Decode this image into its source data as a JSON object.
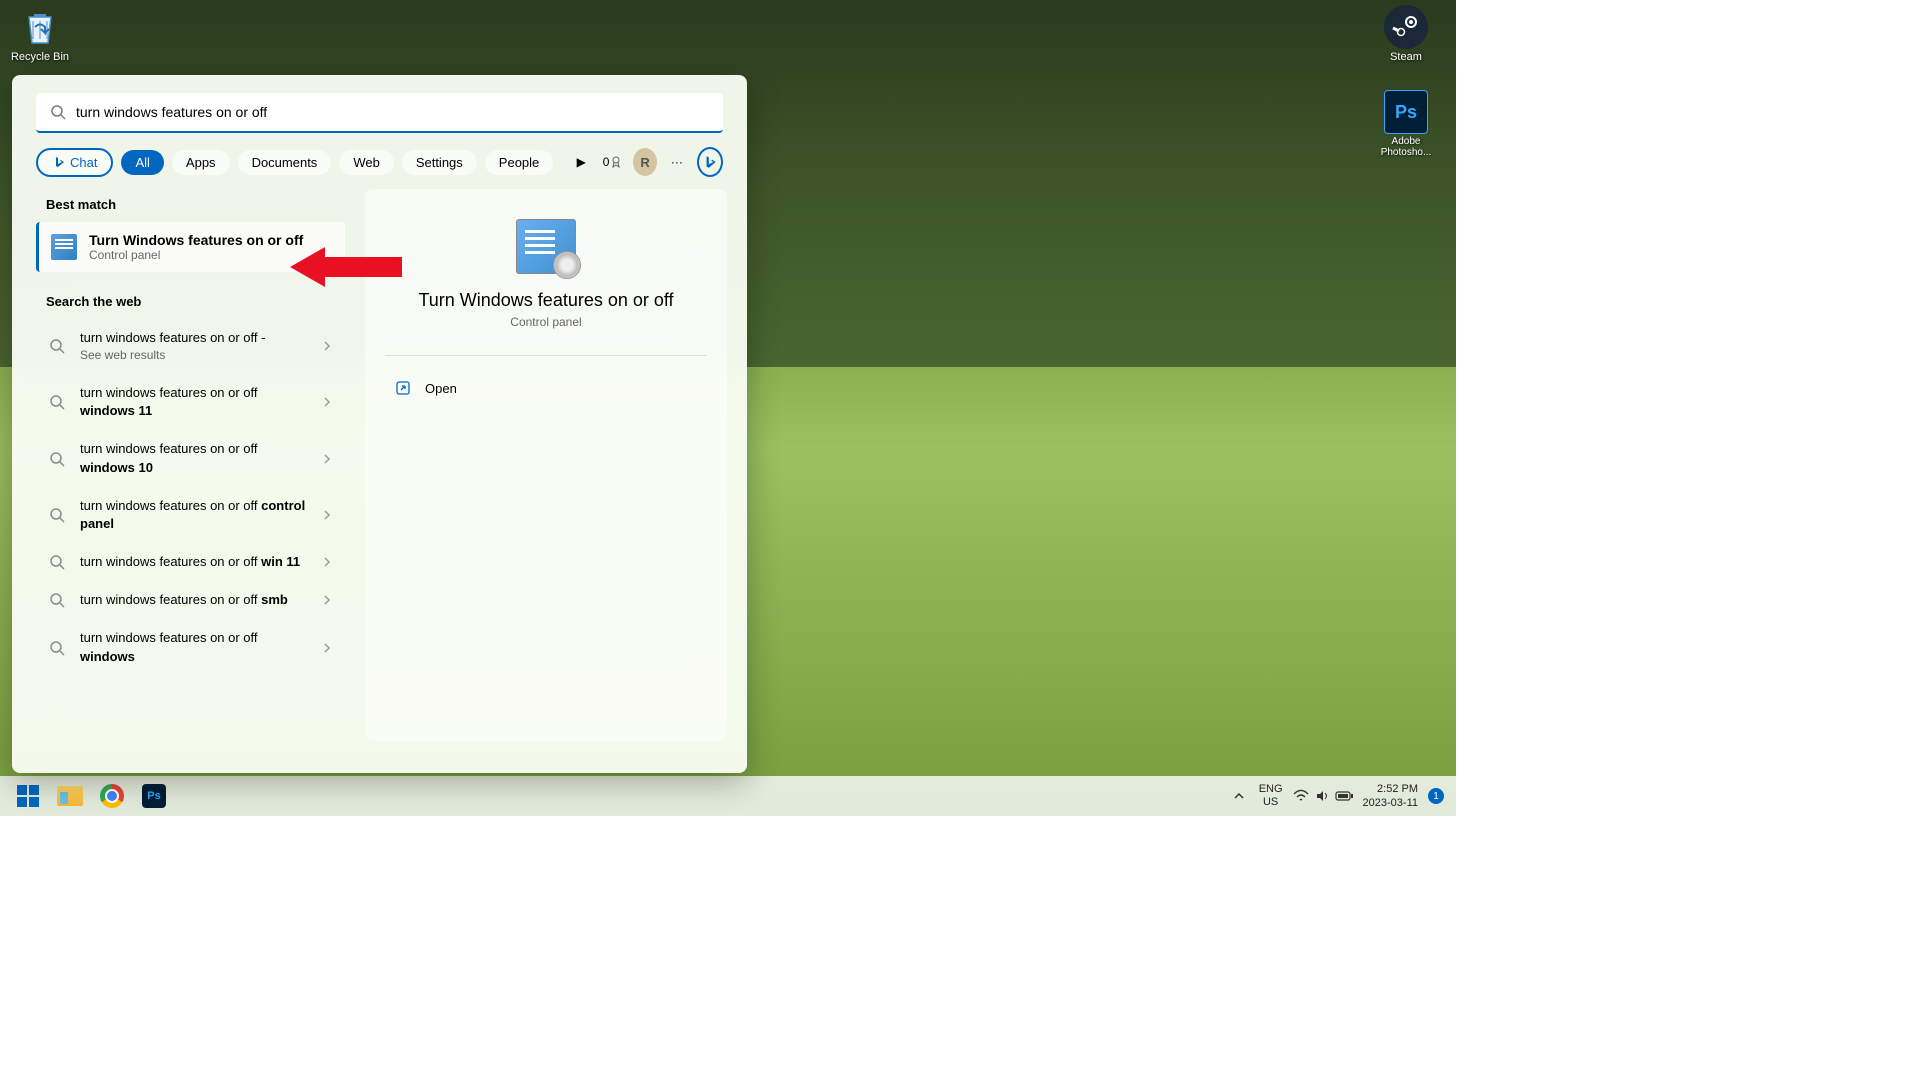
{
  "desktop_icons": {
    "recycle": "Recycle Bin",
    "steam": "Steam",
    "photoshop": "Adobe Photosho..."
  },
  "search": {
    "query": "turn windows features on or off",
    "filters": {
      "chat": "Chat",
      "all": "All",
      "apps": "Apps",
      "documents": "Documents",
      "web": "Web",
      "settings": "Settings",
      "people": "People"
    },
    "rewards": "0",
    "avatar": "R"
  },
  "results": {
    "best_match_label": "Best match",
    "best_match_title": "Turn Windows features on or off",
    "best_match_sub": "Control panel",
    "web_label": "Search the web",
    "web_items": [
      {
        "prefix": "turn windows features on or off - ",
        "bold": "",
        "sub": "See web results"
      },
      {
        "prefix": "turn windows features on or off ",
        "bold": "windows 11",
        "sub": ""
      },
      {
        "prefix": "turn windows features on or off ",
        "bold": "windows 10",
        "sub": ""
      },
      {
        "prefix": "turn windows features on or off ",
        "bold": "control panel",
        "sub": ""
      },
      {
        "prefix": "turn windows features on or off ",
        "bold": "win 11",
        "sub": ""
      },
      {
        "prefix": "turn windows features on or off ",
        "bold": "smb",
        "sub": ""
      },
      {
        "prefix": "turn windows features on or off ",
        "bold": "windows",
        "sub": ""
      }
    ]
  },
  "detail": {
    "title": "Turn Windows features on or off",
    "sub": "Control panel",
    "open": "Open"
  },
  "taskbar": {
    "lang1": "ENG",
    "lang2": "US",
    "time": "2:52 PM",
    "date": "2023-03-11",
    "badge": "1"
  }
}
